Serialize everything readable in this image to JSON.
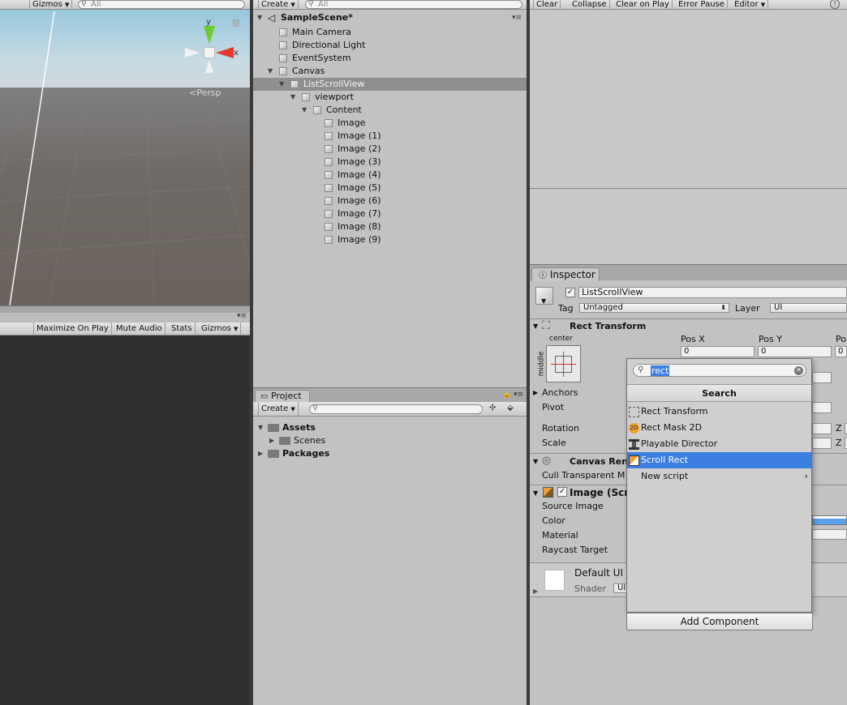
{
  "scene": {
    "gizmos_label": "Gizmos",
    "search_placeholder": "All",
    "persp_label": "Persp",
    "axis_y": "y",
    "axis_x": "x"
  },
  "game": {
    "maximize_on_play": "Maximize On Play",
    "mute_audio": "Mute Audio",
    "stats": "Stats",
    "gizmos": "Gizmos"
  },
  "hierarchy": {
    "create_label": "Create",
    "search_placeholder": "All",
    "scene_name": "SampleScene*",
    "items": [
      {
        "label": "Main Camera",
        "depth": 1,
        "arrow": ""
      },
      {
        "label": "Directional Light",
        "depth": 1,
        "arrow": ""
      },
      {
        "label": "EventSystem",
        "depth": 1,
        "arrow": ""
      },
      {
        "label": "Canvas",
        "depth": 1,
        "arrow": "▼"
      },
      {
        "label": "ListScrollView",
        "depth": 2,
        "arrow": "▼",
        "selected": true
      },
      {
        "label": "viewport",
        "depth": 3,
        "arrow": "▼"
      },
      {
        "label": "Content",
        "depth": 4,
        "arrow": "▼"
      },
      {
        "label": "Image",
        "depth": 5,
        "arrow": ""
      },
      {
        "label": "Image (1)",
        "depth": 5,
        "arrow": ""
      },
      {
        "label": "Image (2)",
        "depth": 5,
        "arrow": ""
      },
      {
        "label": "Image (3)",
        "depth": 5,
        "arrow": ""
      },
      {
        "label": "Image (4)",
        "depth": 5,
        "arrow": ""
      },
      {
        "label": "Image (5)",
        "depth": 5,
        "arrow": ""
      },
      {
        "label": "Image (6)",
        "depth": 5,
        "arrow": ""
      },
      {
        "label": "Image (7)",
        "depth": 5,
        "arrow": ""
      },
      {
        "label": "Image (8)",
        "depth": 5,
        "arrow": ""
      },
      {
        "label": "Image (9)",
        "depth": 5,
        "arrow": ""
      }
    ]
  },
  "project": {
    "tab_label": "Project",
    "create_label": "Create",
    "items": [
      {
        "label": "Assets",
        "depth": 0,
        "arrow": "▼",
        "bold": true
      },
      {
        "label": "Scenes",
        "depth": 1,
        "arrow": "▶",
        "bold": false
      },
      {
        "label": "Packages",
        "depth": 0,
        "arrow": "▶",
        "bold": true
      }
    ]
  },
  "console": {
    "clear": "Clear",
    "collapse": "Collapse",
    "clear_on_play": "Clear on Play",
    "error_pause": "Error Pause",
    "editor": "Editor"
  },
  "inspector": {
    "tab_label": "Inspector",
    "object_name": "ListScrollView",
    "tag_label": "Tag",
    "tag_value": "Untagged",
    "layer_label": "Layer",
    "layer_value": "UI",
    "rect_transform": {
      "title": "Rect Transform",
      "anchor_h": "center",
      "anchor_v": "middle",
      "pos_x_label": "Pos X",
      "pos_y_label": "Pos Y",
      "pos_z_label": "Po",
      "pos_x": "0",
      "pos_y": "0",
      "pos_z": "0",
      "anchors_label": "Anchors",
      "pivot_label": "Pivot",
      "rotation_label": "Rotation",
      "scale_label": "Scale",
      "z_label": "Z"
    },
    "canvas_renderer": {
      "title": "Canvas Ren",
      "cull_label": "Cull Transparent M"
    },
    "image": {
      "title": "Image (Scr",
      "source_image": "Source Image",
      "color": "Color",
      "material": "Material",
      "raycast": "Raycast Target"
    },
    "material_preview": {
      "name": "Default UI",
      "shader_label": "Shader",
      "shader_value": "UI"
    },
    "add_component": "Add Component"
  },
  "component_popup": {
    "search_value": "rect",
    "header": "Search",
    "items": [
      {
        "label": "Rect Transform",
        "icon": "rect-transform-icon",
        "highlighted": false
      },
      {
        "label": "Rect Mask 2D",
        "icon": "rect-mask-2d-icon",
        "highlighted": false
      },
      {
        "label": "Playable Director",
        "icon": "playable-director-icon",
        "highlighted": false
      },
      {
        "label": "Scroll Rect",
        "icon": "scroll-rect-icon",
        "highlighted": true
      },
      {
        "label": "New script",
        "icon": "",
        "highlighted": false,
        "submenu": true
      }
    ],
    "icon_2d_text": "2D"
  },
  "colors": {
    "selection_blue": "#3d7fe0",
    "hierarchy_selected": "#8f8f8f",
    "axis_x": "#e23b2e",
    "axis_y": "#6dcc2a",
    "game_view_bg": "#303030"
  }
}
